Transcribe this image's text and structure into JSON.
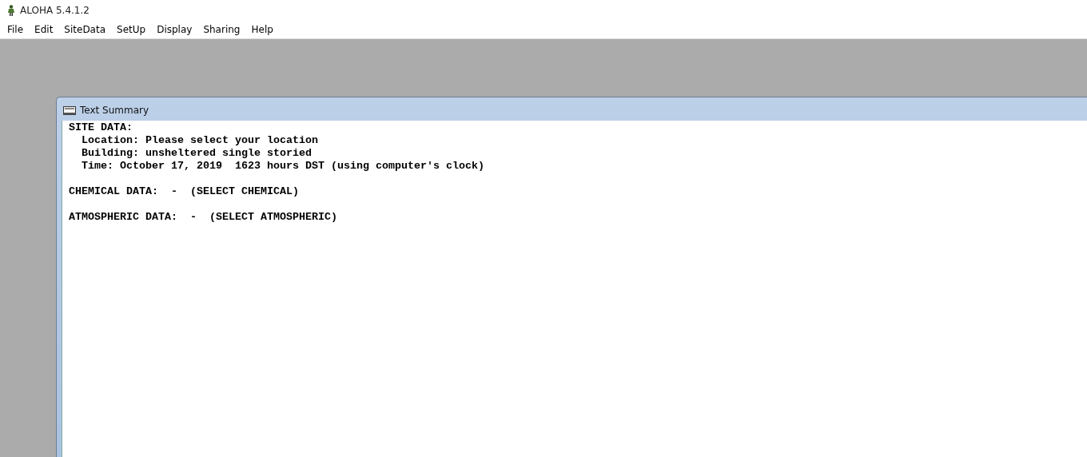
{
  "window": {
    "title": "ALOHA 5.4.1.2"
  },
  "menu": [
    {
      "label": "File"
    },
    {
      "label": "Edit"
    },
    {
      "label": "SiteData"
    },
    {
      "label": "SetUp"
    },
    {
      "label": "Display"
    },
    {
      "label": "Sharing"
    },
    {
      "label": "Help"
    }
  ],
  "child_window": {
    "title": "Text Summary",
    "sections": [
      {
        "text": "SITE DATA:",
        "children": [
          {
            "text": "Location: Please select your location"
          },
          {
            "text": "Building: unsheltered single storied"
          },
          {
            "text": "Time: October 17, 2019  1623 hours DST (using computer's clock)"
          }
        ]
      },
      {
        "text": "CHEMICAL DATA:  -  (SELECT CHEMICAL)"
      },
      {
        "text": "ATMOSPHERIC DATA:  -  (SELECT ATMOSPHERIC)"
      }
    ]
  }
}
